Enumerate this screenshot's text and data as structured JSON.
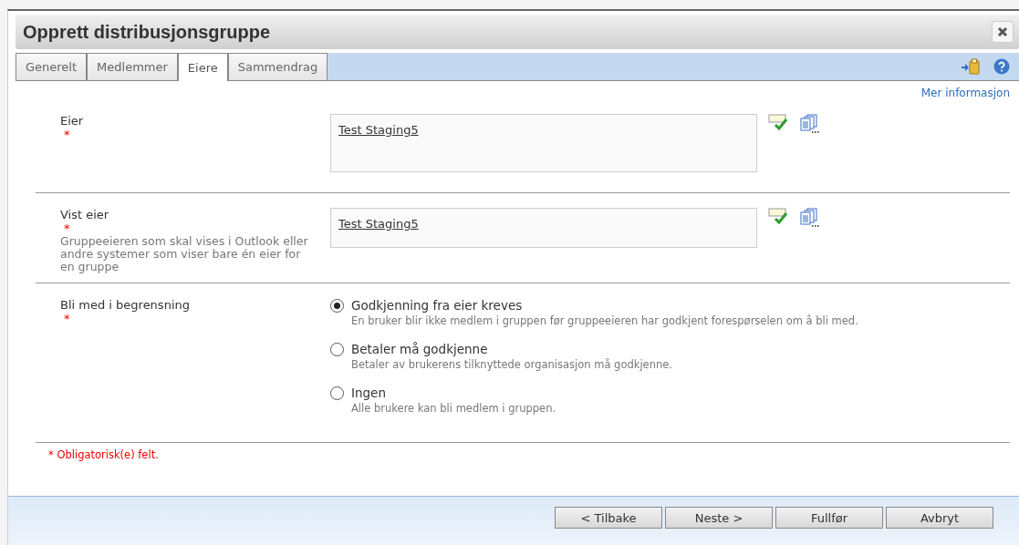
{
  "window": {
    "title": "Opprett distribusjonsgruppe"
  },
  "tabs": [
    {
      "label": "Generelt",
      "selected": false
    },
    {
      "label": "Medlemmer",
      "selected": false
    },
    {
      "label": "Eiere",
      "selected": true
    },
    {
      "label": "Sammendrag",
      "selected": false
    }
  ],
  "more_info": "Mer informasjon",
  "fields": [
    {
      "label": "Eier",
      "required_mark": "*",
      "value": "Test Staging5",
      "kind": "tall"
    },
    {
      "label": "Vist eier",
      "required_mark": "*",
      "description": "Gruppeeieren som skal vises i Outlook eller andre systemer som viser bare én eier for en gruppe",
      "value": "Test Staging5",
      "kind": "short"
    }
  ],
  "join_restriction": {
    "label": "Bli med i begrensning",
    "required_mark": "*",
    "options": [
      {
        "label": "Godkjenning fra eier kreves",
        "description": "En bruker blir ikke medlem i gruppen før gruppeeieren har godkjent forespørselen om å bli med.",
        "selected": true
      },
      {
        "label": "Betaler må godkjenne",
        "description": "Betaler av brukerens tilknyttede organisasjon må godkjenne.",
        "selected": false
      },
      {
        "label": "Ingen",
        "description": "Alle brukere kan bli medlem i gruppen.",
        "selected": false
      }
    ]
  },
  "required_note": "* Obligatorisk(e) felt.",
  "buttons": [
    "< Tilbake",
    "Neste >",
    "Fullfør",
    "Avbryt"
  ]
}
